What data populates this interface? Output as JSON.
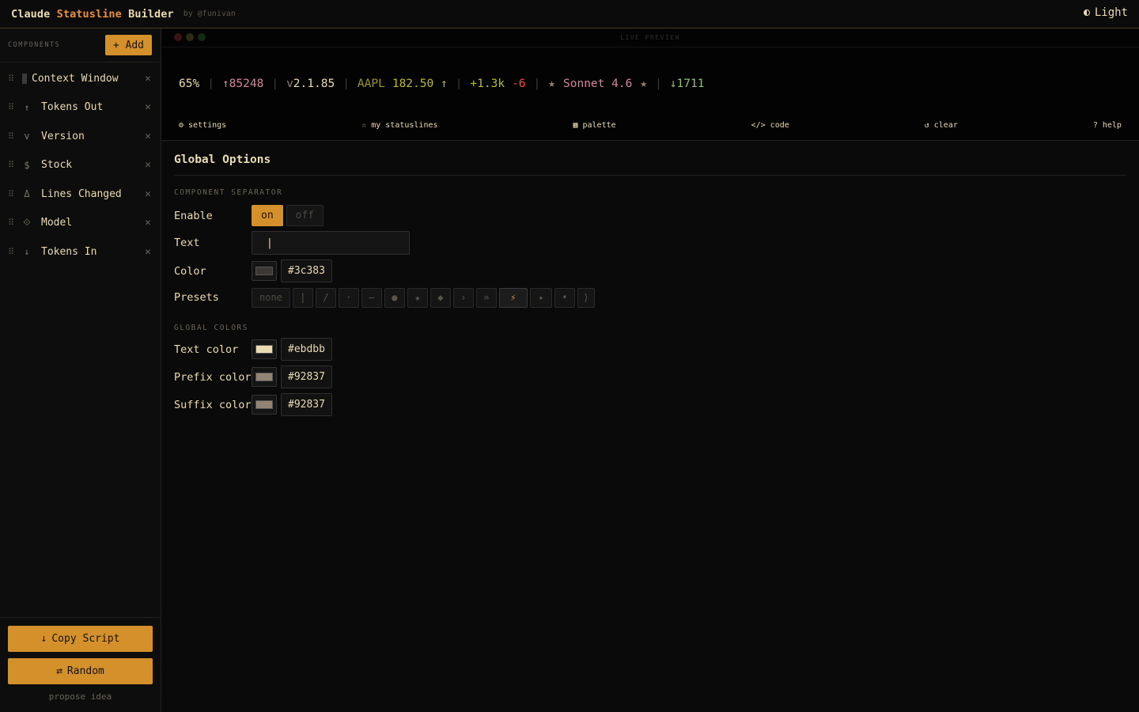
{
  "header": {
    "brand_1": "Claude",
    "brand_2": "Statusline",
    "brand_3": "Builder",
    "byline": "by @funivan",
    "theme_label": "Light"
  },
  "sidebar": {
    "components_label": "COMPONENTS",
    "add_label": "+ Add",
    "items": [
      {
        "icon": "block-icon",
        "glyph": "",
        "label": "Context Window"
      },
      {
        "icon": "arrow-up-icon",
        "glyph": "↑",
        "label": "Tokens Out"
      },
      {
        "icon": "version-icon",
        "glyph": "v",
        "label": "Version"
      },
      {
        "icon": "dollar-icon",
        "glyph": "$",
        "label": "Stock"
      },
      {
        "icon": "delta-icon",
        "glyph": "Δ",
        "label": "Lines Changed"
      },
      {
        "icon": "diamond-icon",
        "glyph": "⟐",
        "label": "Model"
      },
      {
        "icon": "arrow-down-icon",
        "glyph": "↓",
        "label": "Tokens In"
      }
    ],
    "copy_label": "Copy Script",
    "random_label": "Random",
    "propose_label": "propose idea"
  },
  "preview": {
    "label": "LIVE PREVIEW",
    "segments": {
      "context": "65%",
      "tokens_out": "↑85248",
      "version_prefix": "v",
      "version": "2.1.85",
      "stock_symbol": "AAPL",
      "stock_price": "182.50 ↑",
      "lines_added": "+1.3k",
      "lines_removed": "-6",
      "model_prefix": "★",
      "model": "Sonnet 4.6",
      "model_suffix": "★",
      "tokens_in": "↓1711"
    },
    "separator": "|",
    "actions": {
      "settings": "⚙ settings",
      "my_statuslines": "☆ my statuslines",
      "palette": "▦ palette",
      "code": "</> code",
      "clear": "↺ clear",
      "help": "? help"
    }
  },
  "options": {
    "title": "Global Options",
    "separator_section": "COMPONENT SEPARATOR",
    "enable_label": "Enable",
    "on_label": "on",
    "off_label": "off",
    "text_label": "Text",
    "text_value": "|",
    "color_label": "Color",
    "color_value": "#3c383",
    "presets_label": "Presets",
    "presets": [
      "none",
      "|",
      "/",
      "·",
      "—",
      "●",
      "★",
      "◆",
      "›",
      "»",
      "⚡",
      "✦",
      "•",
      "⟩"
    ],
    "colors_section": "GLOBAL COLORS",
    "text_color_label": "Text color",
    "text_color_value": "#ebdbb",
    "prefix_color_label": "Prefix color",
    "prefix_color_value": "#92837",
    "suffix_color_label": "Suffix color",
    "suffix_color_value": "#92837"
  },
  "colors": {
    "accent": "#d4912b",
    "brand_orange": "#e8913d",
    "text": "#ebdbb2",
    "separator": "#3c3836",
    "prefix": "#928374",
    "tokens_out": "#d3869b",
    "stock": "#b8bb26",
    "lines_added": "#b8bb26",
    "lines_removed": "#fb4934",
    "model": "#d3869b",
    "tokens_in": "#8ec07c",
    "swatch_separator": "#3c3836",
    "swatch_text": "#ebdbb2",
    "swatch_prefix": "#928374",
    "swatch_suffix": "#928374"
  }
}
